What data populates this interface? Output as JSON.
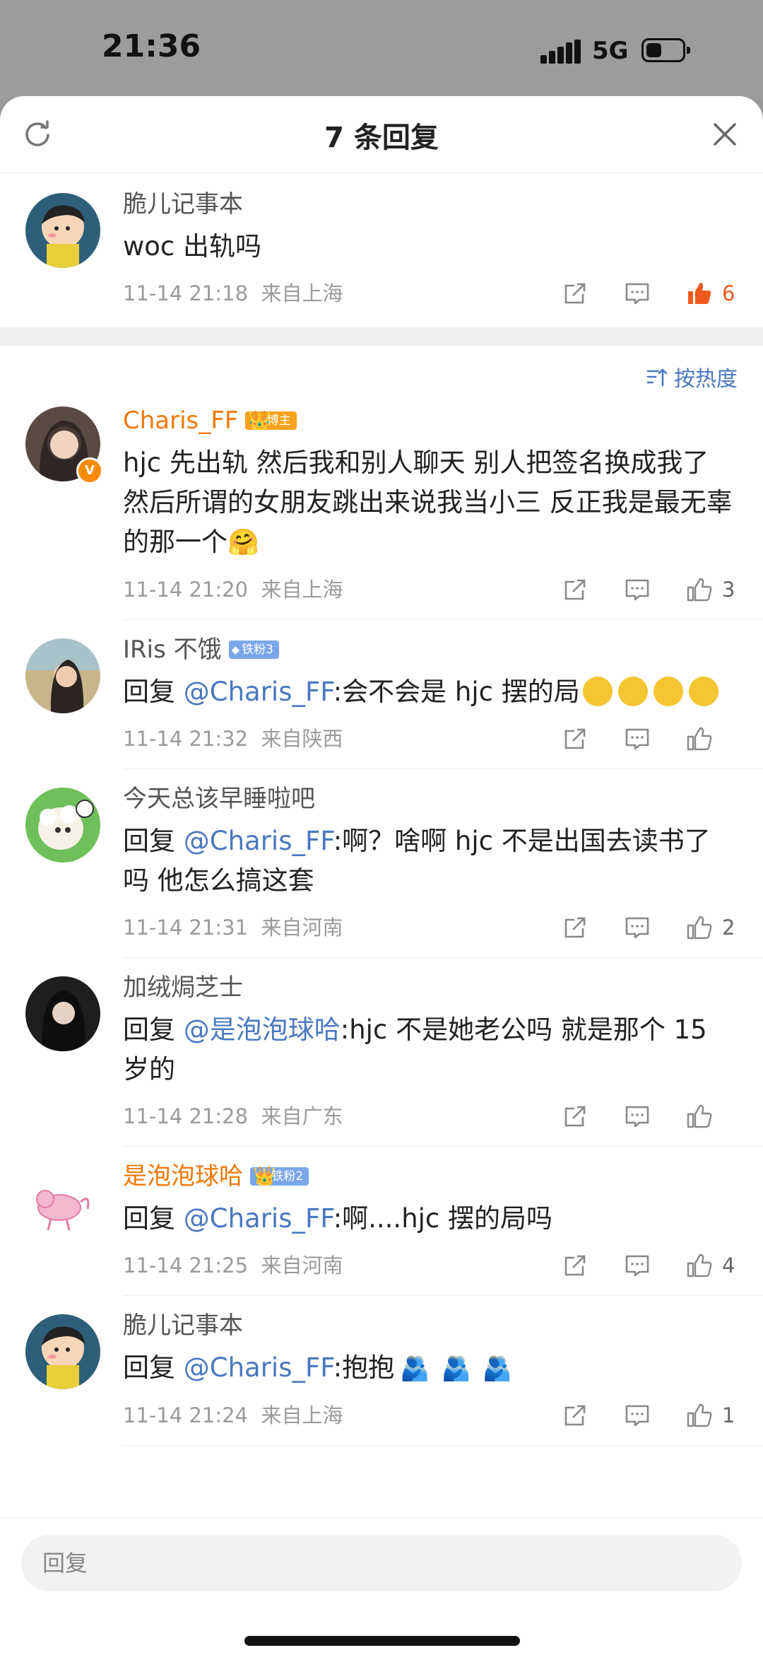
{
  "status": {
    "time": "21:36",
    "network": "5G"
  },
  "sheet": {
    "title": "7 条回复"
  },
  "main_comment": {
    "username": "脆儿记事本",
    "text": "woc 出轨吗",
    "date": "11-14 21:18",
    "location": "来自上海",
    "likes": "6"
  },
  "sort_label": "按热度",
  "replies": [
    {
      "username": "Charis_FF",
      "badge": "博主",
      "text": "hjc 先出轨 然后我和别人聊天 别人把签名换成我了 然后所谓的女朋友跳出来说我当小三 反正我是最无辜的那一个",
      "emoji": "🤗",
      "date": "11-14 21:20",
      "location": "来自上海",
      "likes": "3"
    },
    {
      "username": "IRis 不饿",
      "badge": "铁粉3",
      "reply_prefix": "回复 ",
      "mention": "@Charis_FF",
      "text": ":会不会是 hjc 摆的局",
      "date": "11-14 21:32",
      "location": "来自陕西",
      "likes": ""
    },
    {
      "username": "今天总该早睡啦吧",
      "reply_prefix": "回复 ",
      "mention": "@Charis_FF",
      "text": ":啊？啥啊 hjc 不是出国去读书了吗 他怎么搞这套",
      "date": "11-14 21:31",
      "location": "来自河南",
      "likes": "2"
    },
    {
      "username": "加绒焗芝士",
      "reply_prefix": "回复 ",
      "mention": "@是泡泡球哈",
      "text": ":hjc 不是她老公吗 就是那个 15 岁的",
      "date": "11-14 21:28",
      "location": "来自广东",
      "likes": ""
    },
    {
      "username": "是泡泡球哈",
      "badge": "铁粉2",
      "reply_prefix": "回复 ",
      "mention": "@Charis_FF",
      "text": ":啊....hjc 摆的局吗",
      "date": "11-14 21:25",
      "location": "来自河南",
      "likes": "4"
    },
    {
      "username": "脆儿记事本",
      "reply_prefix": "回复 ",
      "mention": "@Charis_FF",
      "text": ":抱抱",
      "emoji": "🫂",
      "date": "11-14 21:24",
      "location": "来自上海",
      "likes": "1"
    }
  ],
  "input": {
    "placeholder": "回复"
  },
  "colors": {
    "accent": "#4a78c0",
    "orange": "#f0790a",
    "like_red": "#ef5a1c"
  }
}
